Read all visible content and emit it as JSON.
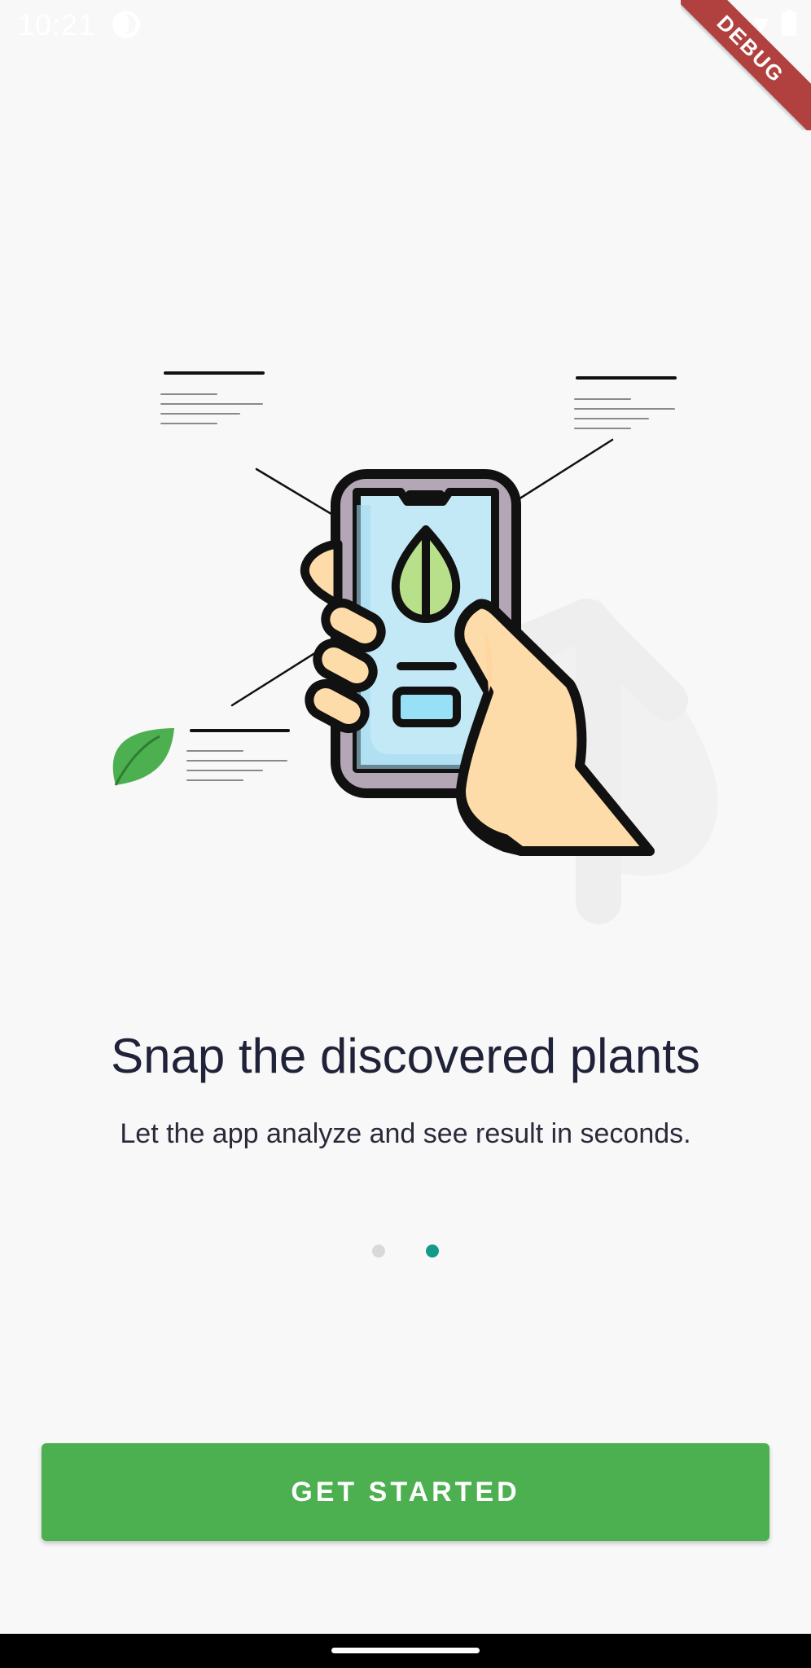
{
  "status_bar": {
    "time": "10:21"
  },
  "debug_banner": {
    "label": "DEBUG"
  },
  "onboarding": {
    "title": "Snap the discovered plants",
    "subtitle": "Let the app analyze and see result in seconds.",
    "page_indicator": {
      "total": 2,
      "current": 2
    },
    "cta_label": "GET STARTED"
  },
  "colors": {
    "primary_green": "#4caf50",
    "indicator_active": "#139b87",
    "indicator_inactive": "#d9d9d9",
    "title_text": "#1f2238"
  },
  "icons": [
    "app-notification-icon",
    "wifi-icon",
    "battery-icon",
    "leaf-icon",
    "phone-in-hand-illustration"
  ]
}
